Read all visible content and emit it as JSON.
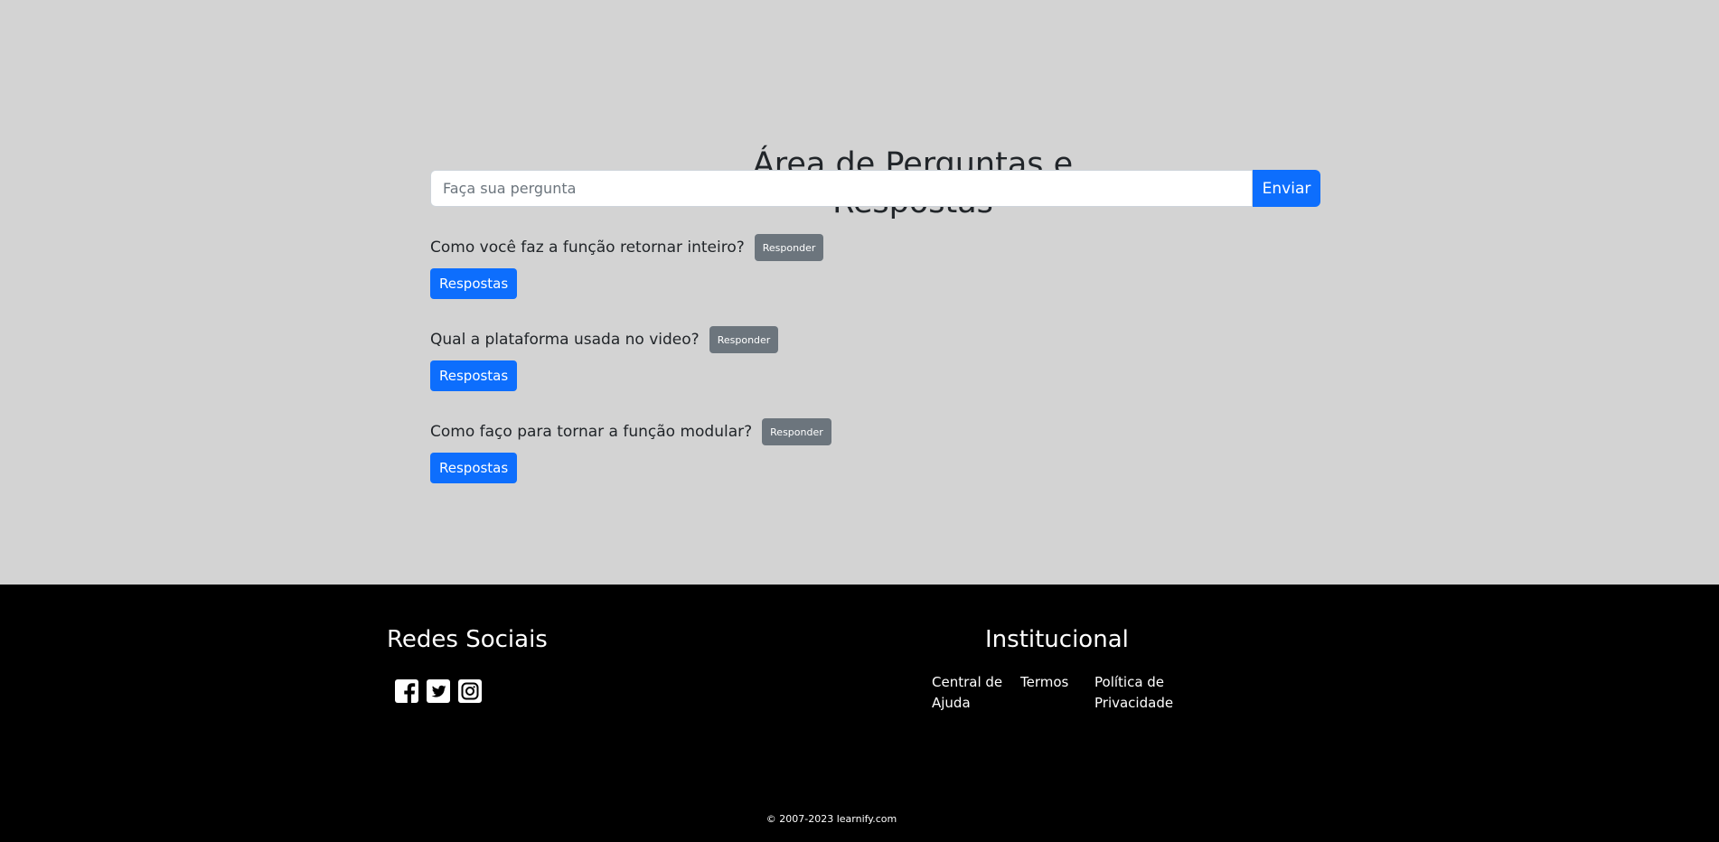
{
  "main": {
    "title": "Área de Perguntas e Respostas",
    "ask": {
      "placeholder": "Faça sua pergunta",
      "value": "",
      "send_label": "Enviar"
    },
    "questions": [
      {
        "text": "Como você faz a função retornar inteiro?",
        "reply_label": "Responder",
        "answers_label": "Respostas"
      },
      {
        "text": "Qual a plataforma usada no video?",
        "reply_label": "Responder",
        "answers_label": "Respostas"
      },
      {
        "text": "Como faço para tornar a função modular?",
        "reply_label": "Responder",
        "answers_label": "Respostas"
      }
    ]
  },
  "footer": {
    "social_title": "Redes Sociais",
    "social_icons": [
      "facebook-icon",
      "twitter-icon",
      "instagram-icon"
    ],
    "institutional_title": "Institucional",
    "links": [
      "Central de Ajuda",
      "Termos",
      "Política de Privacidade"
    ],
    "copyright": "© 2007-2023 learnify.com"
  },
  "colors": {
    "page_background": "#d3d3d3",
    "footer_background": "#000000",
    "primary": "#0d6efd",
    "secondary": "#6c757d",
    "text": "#212529"
  }
}
